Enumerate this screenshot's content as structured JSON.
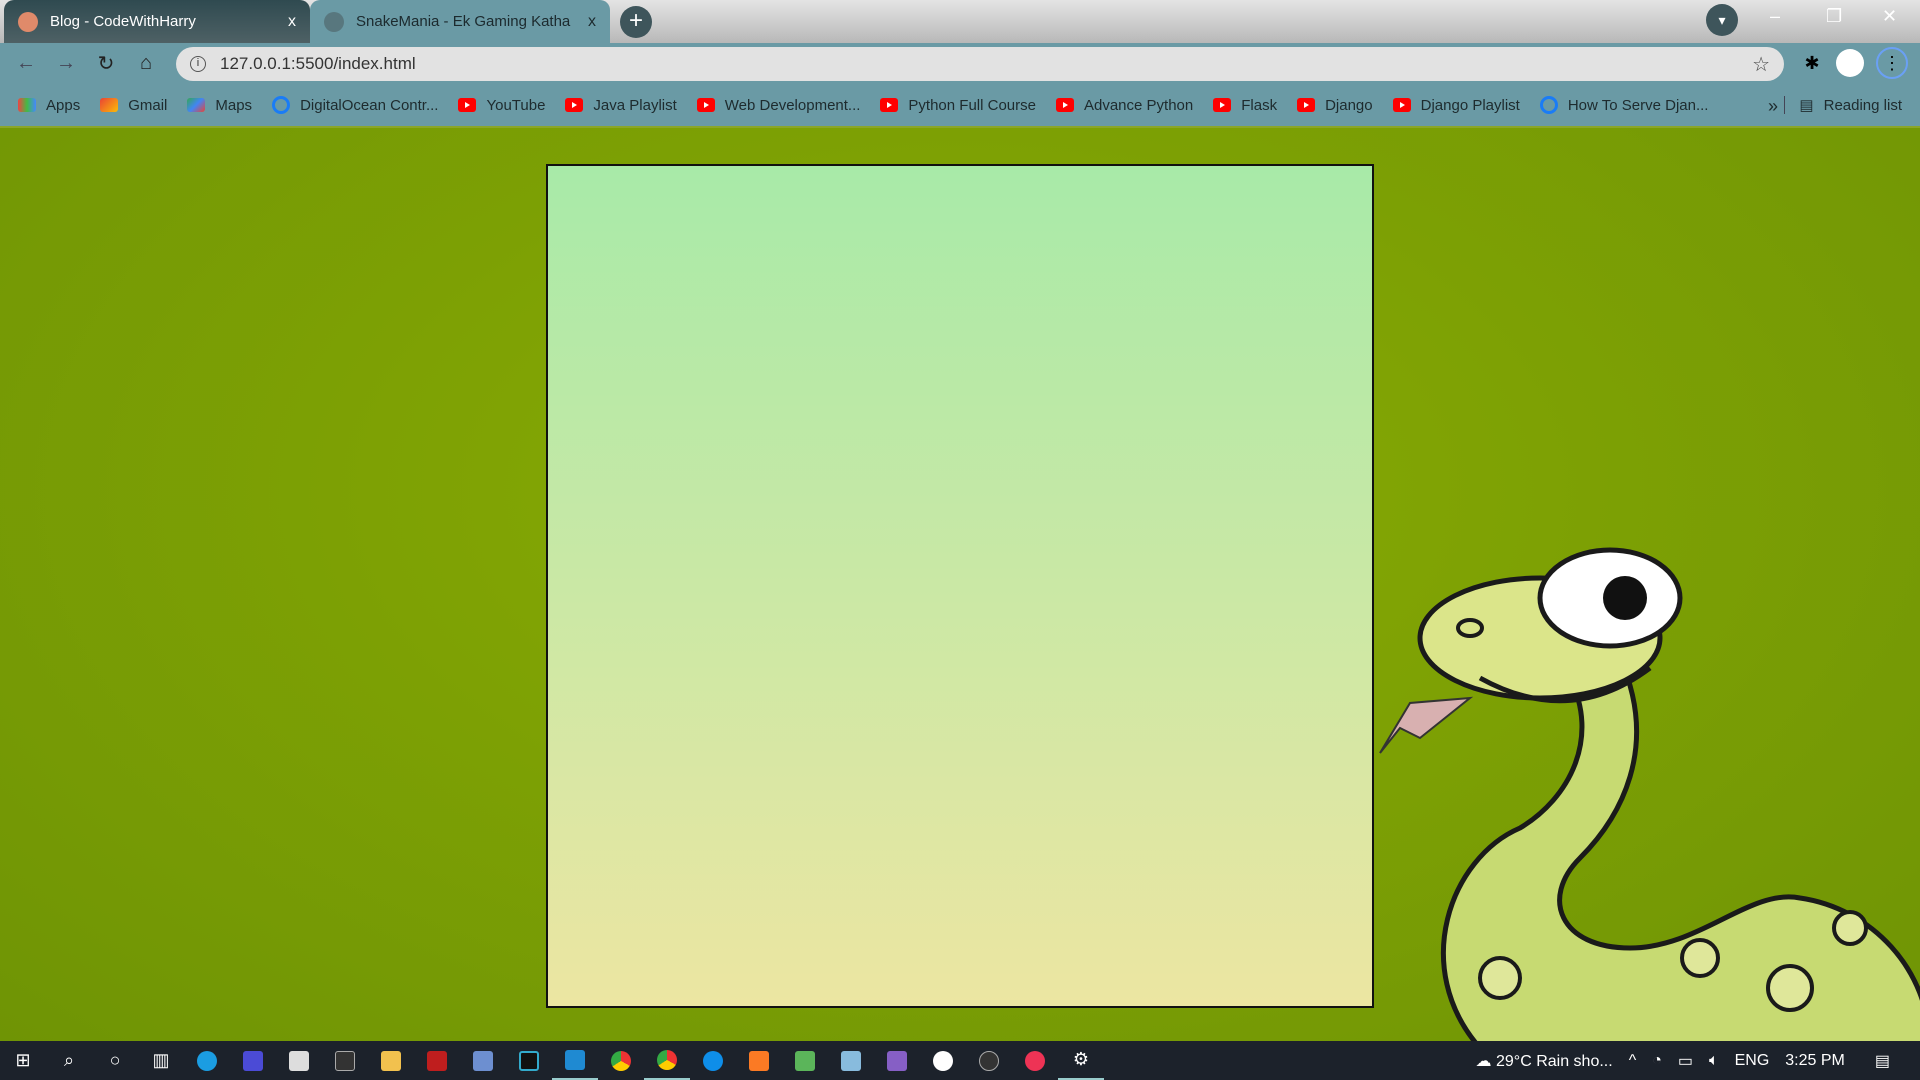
{
  "browser": {
    "tabs": [
      {
        "title": "Blog - CodeWithHarry",
        "close": "x"
      },
      {
        "title": "SnakeMania - Ek Gaming Katha",
        "close": "x"
      }
    ],
    "new_tab": "+",
    "address": "127.0.0.1:5500/index.html",
    "bookmarks": [
      {
        "label": "Apps",
        "icon": "apps-icon"
      },
      {
        "label": "Gmail",
        "icon": "gmail-icon"
      },
      {
        "label": "Maps",
        "icon": "maps-icon"
      },
      {
        "label": "DigitalOcean Contr...",
        "icon": "digitalocean-icon"
      },
      {
        "label": "YouTube",
        "icon": "youtube-icon"
      },
      {
        "label": "Java Playlist",
        "icon": "youtube-icon"
      },
      {
        "label": "Web Development...",
        "icon": "youtube-icon"
      },
      {
        "label": "Python Full Course",
        "icon": "youtube-icon"
      },
      {
        "label": "Advance Python",
        "icon": "youtube-icon"
      },
      {
        "label": "Flask",
        "icon": "youtube-icon"
      },
      {
        "label": "Django",
        "icon": "youtube-icon"
      },
      {
        "label": "Django Playlist",
        "icon": "youtube-icon"
      },
      {
        "label": "How To Serve Djan...",
        "icon": "digitalocean-icon"
      }
    ],
    "more": "»",
    "reading_list": "Reading list"
  },
  "colors": {
    "board_top": "#a8eaa8",
    "board_bottom": "#ece6a2",
    "background": "#7a9e06"
  },
  "taskbar": {
    "weather": "29°C  Rain sho...",
    "lang": "ENG",
    "time": "3:25 PM"
  }
}
